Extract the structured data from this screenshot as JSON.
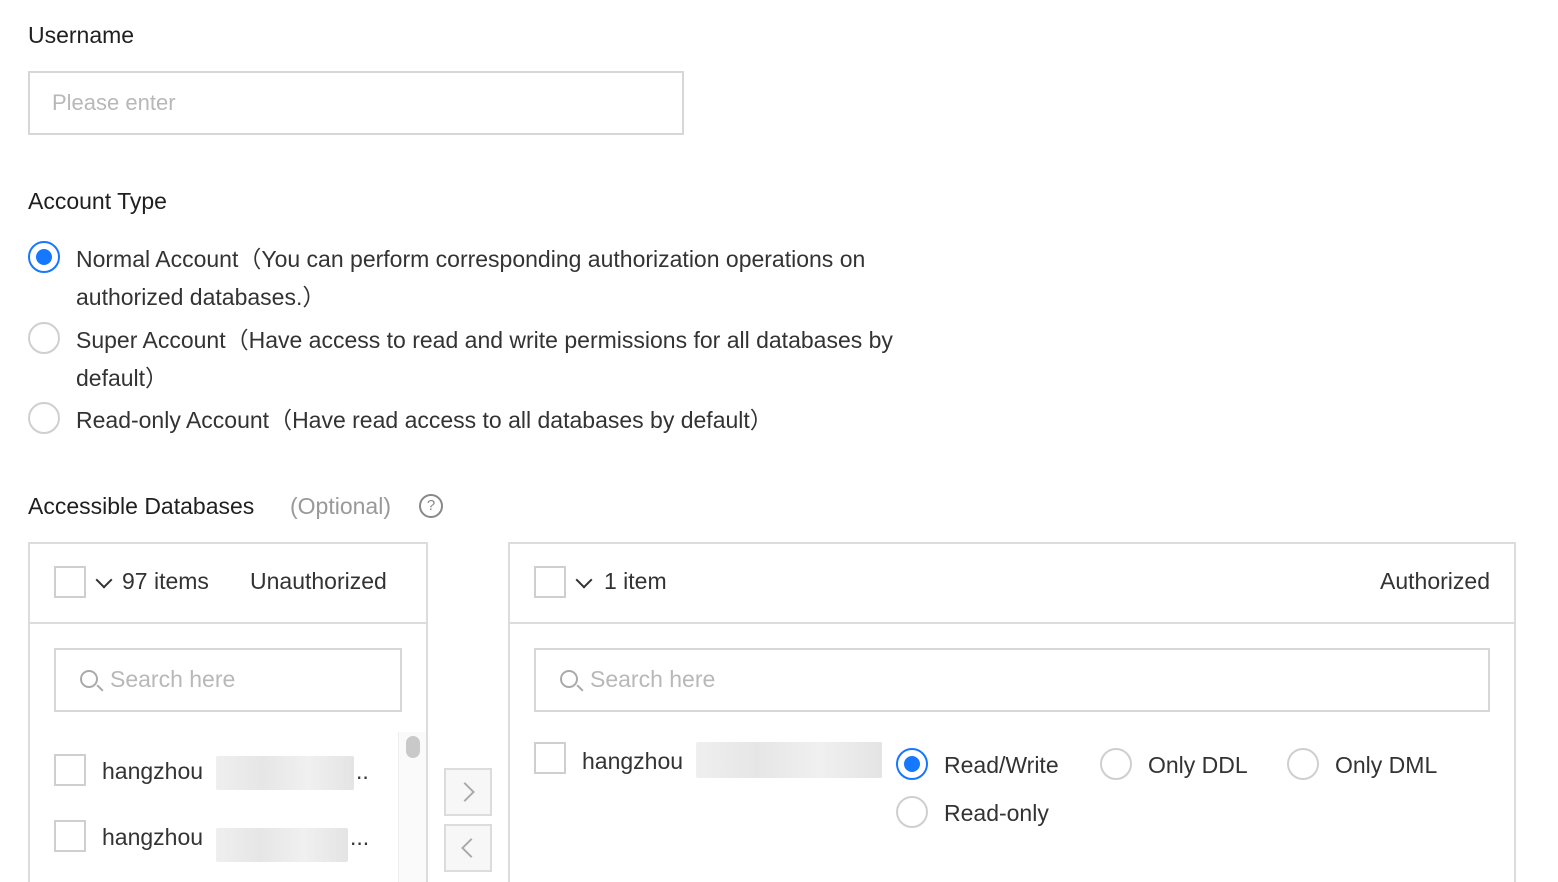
{
  "username": {
    "label": "Username",
    "placeholder": "Please enter"
  },
  "account_type": {
    "label": "Account Type",
    "options": [
      {
        "line1": "Normal Account（You can perform corresponding authorization operations on",
        "line2": "authorized databases.）",
        "selected": true
      },
      {
        "line1": "Super Account（Have access to read and write permissions for all databases by",
        "line2": "default）",
        "selected": false
      },
      {
        "line1": "Read-only Account（Have read access to all databases by default）",
        "selected": false
      }
    ]
  },
  "accessible_databases": {
    "label": "Accessible Databases",
    "optional": "(Optional)",
    "help_icon": "question-circle-icon",
    "help_glyph": "?"
  },
  "left_panel": {
    "count": "97 items",
    "title": "Unauthorized",
    "search_placeholder": "Search here",
    "items": [
      {
        "prefix": "hangzhou",
        "suffix": ".."
      },
      {
        "prefix": "hangzhou",
        "suffix": "..."
      }
    ]
  },
  "right_panel": {
    "count": "1 item",
    "title": "Authorized",
    "search_placeholder": "Search here",
    "items": [
      {
        "prefix": "hangzhou",
        "permissions": [
          {
            "label": "Read/Write",
            "selected": true
          },
          {
            "label": "Only DDL",
            "selected": false
          },
          {
            "label": "Only DML",
            "selected": false
          },
          {
            "label": "Read-only",
            "selected": false
          }
        ]
      }
    ]
  },
  "transfer": {
    "move_right_icon": "chevron-right-icon",
    "move_left_icon": "chevron-left-icon"
  },
  "colors": {
    "primary": "#1677ff",
    "border": "#dcdcdc",
    "placeholder": "#b8b8b8"
  }
}
